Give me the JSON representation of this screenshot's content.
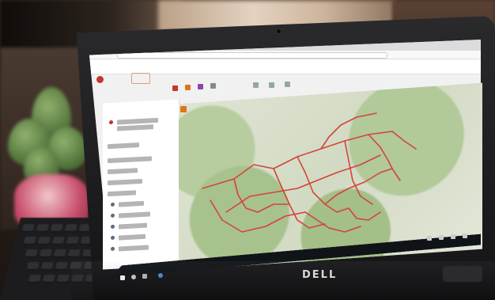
{
  "scene": {
    "description_type": "photo",
    "laptop_brand": "DELL"
  },
  "browser": {
    "tabs": [
      "",
      ""
    ]
  },
  "app": {
    "logo_text": "",
    "map_tag": ""
  },
  "colors": {
    "route_line": "#d2453a",
    "map_background": "#dde2d1",
    "accent": "#e0731d",
    "taskbar": "#101418"
  },
  "icons": [
    "windows-start-icon",
    "search-icon",
    "task-view-icon",
    "browser-icon"
  ]
}
